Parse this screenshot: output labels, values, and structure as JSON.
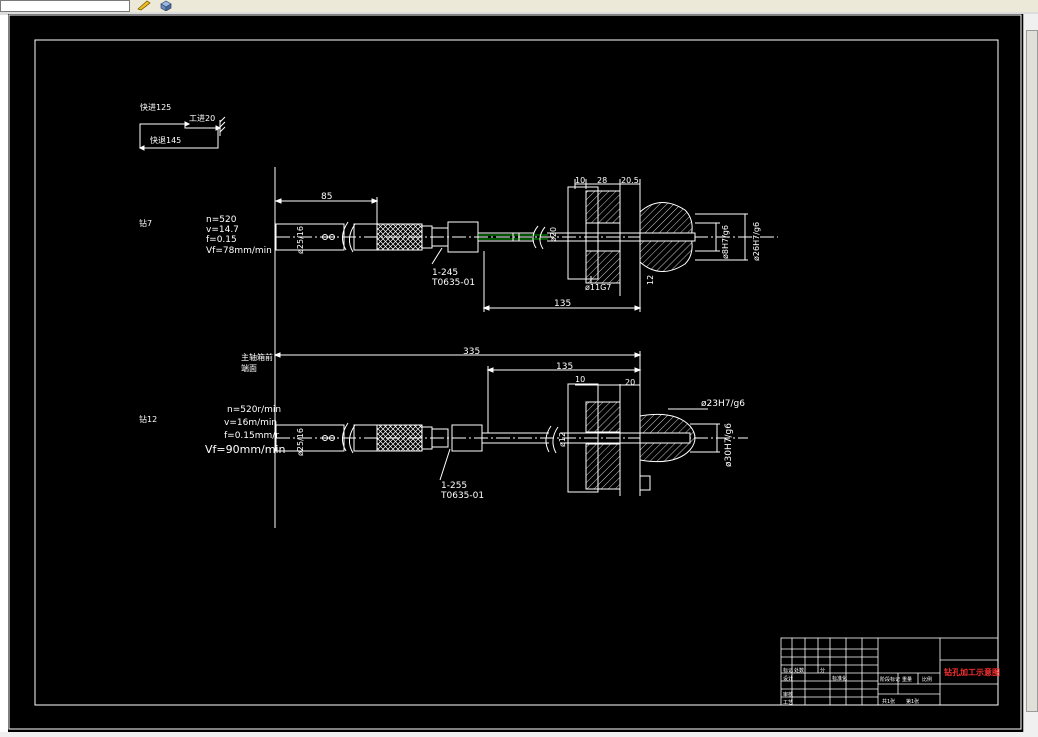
{
  "toolbar": {
    "icons": [
      "pencil-icon",
      "cube-icon"
    ]
  },
  "colors": {
    "background": "#000000",
    "lines": "#ffffff",
    "centerline": "#00aa00",
    "title_text": "#ff3030"
  },
  "cycle": {
    "rapid_in": "快进125",
    "work_feed": "工进20",
    "rapid_out": "快退145"
  },
  "upper": {
    "tool_label": "钻7",
    "n": "n=520",
    "v": "v=14.7",
    "f": "f=0.15",
    "vf": "Vf=78mm/min",
    "shank_dia": "ø25/16",
    "dim_85": "85",
    "dim_10": "10",
    "dim_28": "28",
    "dim_20_5": "20.5",
    "part_no": "1-245",
    "part_code": "T0635-01",
    "bore": "ø8H7/g6",
    "bore2": "ø26H7/g6",
    "guide": "ø11G7",
    "small": "ø20",
    "dim_12": "12",
    "dim_135": "135"
  },
  "spindle": {
    "label_line1": "主轴箱前",
    "label_line2": "端面",
    "dim_335": "335"
  },
  "lower": {
    "tool_label": "钻12",
    "n": "n=520r/min",
    "v": "v=16m/min",
    "f": "f=0.15mm/r",
    "vf": "Vf=90mm/min",
    "shank_dia": "ø25/16",
    "dim_135": "135",
    "dim_10": "10",
    "dim_20": "20",
    "fit1": "ø23H7/g6",
    "fit2": "ø30H7/g6",
    "inner": "ø12",
    "part_no": "1-255",
    "part_code": "T0635-01"
  },
  "title_block": {
    "title": "钻孔加工示意图",
    "r1": "标记",
    "r2": "处数",
    "r3": "分",
    "r4": "设计",
    "r5": "标准化",
    "r6": "审核",
    "r7": "工艺",
    "r8": "阶段标记",
    "r9": "重量",
    "r10": "比例",
    "r11": "共1张",
    "r12": "第1张"
  }
}
